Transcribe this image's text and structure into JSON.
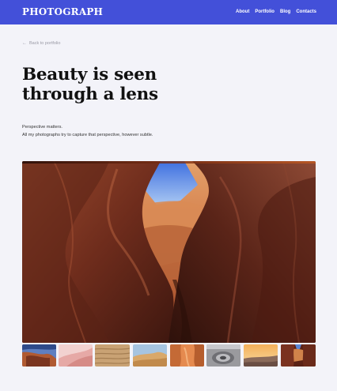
{
  "header": {
    "brand": "PHOTOGRAPH",
    "nav": [
      "About",
      "Portfolio",
      "Blog",
      "Contacts"
    ],
    "background_color": "#4350d9"
  },
  "back_link": {
    "icon": "arrow-left-icon",
    "label": "Back to portfolio"
  },
  "hero": {
    "title_lines": [
      "Beauty is seen",
      "through a lens"
    ],
    "description_lines": [
      "Perspective matters.",
      "All my photographs try to capture that perspective, however subtle."
    ]
  },
  "gallery": {
    "main_image": "antelope-canyon-photo",
    "thumbnails": [
      "rock-sky-thumbnail",
      "pink-sand-thumbnail",
      "sand-ripples-thumbnail",
      "desert-dunes-thumbnail",
      "orange-canyon-thumbnail",
      "circular-rock-thumbnail",
      "sunset-desert-thumbnail",
      "canyon-thumbnail"
    ]
  }
}
